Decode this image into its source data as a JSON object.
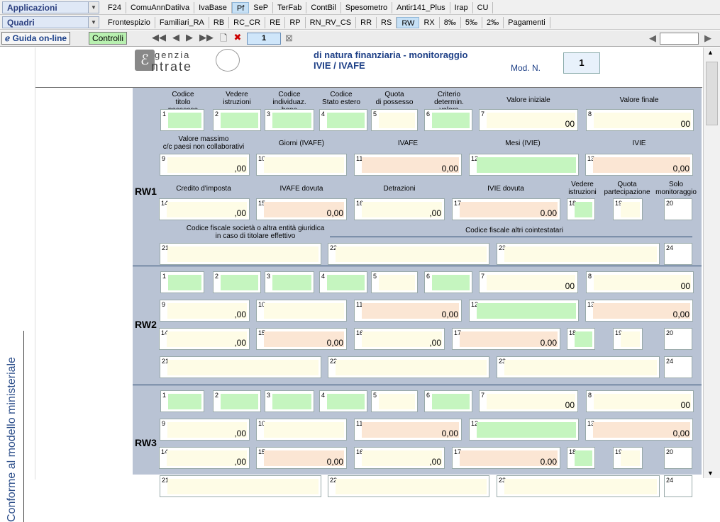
{
  "menu": {
    "app_label": "Applicazioni",
    "quadri_label": "Quadri"
  },
  "tabs_row1": [
    "F24",
    "ComuAnnDatiIva",
    "IvaBase",
    "Pf",
    "SeP",
    "TerFab",
    "ContBil",
    "Spesometro",
    "Antir141_Plus",
    "Irap",
    "CU"
  ],
  "tabs_row2": [
    "Frontespizio",
    "Familiari_RA",
    "RB",
    "RC_CR",
    "RE",
    "RP",
    "RN_RV_CS",
    "RR",
    "RS",
    "RW",
    "RX",
    "8‰",
    "5‰",
    "2‰",
    "Pagamenti"
  ],
  "toolbar": {
    "guida": "Guida on-line",
    "controlli": "Controlli",
    "page": "1"
  },
  "header": {
    "agency1": "genzia",
    "agency2": "ntrate",
    "title": "di natura finanziaria - monitoraggio",
    "subtitle": "IVIE / IVAFE",
    "mod_label": "Mod. N.",
    "mod_value": "1"
  },
  "sidebar": {
    "text": "Conforme al modello ministeriale"
  },
  "labels": {
    "c1": "Codice\ntitolo possesso",
    "c2": "Vedere\nistruzioni",
    "c3": "Codice\nindividuaz. bene",
    "c4": "Codice\nStato estero",
    "c5": "Quota\ndi possesso",
    "c6": "Criterio\ndetermin. valore",
    "c7": "Valore iniziale",
    "c8": "Valore finale",
    "c9": "Valore massimo\nc/c paesi non collaborativi",
    "c10": "Giorni (IVAFE)",
    "c11": "IVAFE",
    "c12": "Mesi (IVIE)",
    "c13": "IVIE",
    "c14": "Credito d'imposta",
    "c15": "IVAFE dovuta",
    "c16": "Detrazioni",
    "c17": "IVIE dovuta",
    "c18": "Vedere\nistruzioni",
    "c19": "Quota\npartecipazione",
    "c20": "Solo\nmonitoraggio",
    "c21": "Codice fiscale società o altra entità giuridica\nin caso di titolare effettivo",
    "c22": "Codice fiscale altri cointestatari"
  },
  "rows": [
    "RW1",
    "RW2",
    "RW3"
  ],
  "values": {
    "v00": ",00",
    "v000": "0,00",
    "v0": "00"
  }
}
